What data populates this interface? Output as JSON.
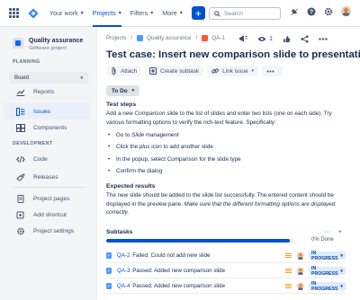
{
  "nav": {
    "your_work": "Your work",
    "projects": "Projects",
    "filters": "Filters",
    "more": "More",
    "create": "+",
    "search_placeholder": "Search"
  },
  "sidebar": {
    "project_name": "Quality assurance",
    "project_type": "Software project",
    "planning_label": "PLANNING",
    "board_select": "Board",
    "items_planning": [
      {
        "label": "Reports",
        "icon": "chart-icon"
      },
      {
        "label": "Issues",
        "icon": "issues-icon"
      },
      {
        "label": "Components",
        "icon": "components-icon"
      }
    ],
    "development_label": "DEVELOPMENT",
    "items_dev": [
      {
        "label": "Code",
        "icon": "code-icon"
      },
      {
        "label": "Releases",
        "icon": "ship-icon"
      }
    ],
    "items_bottom": [
      {
        "label": "Project pages",
        "icon": "page-icon"
      },
      {
        "label": "Add shortcut",
        "icon": "shortcut-icon"
      },
      {
        "label": "Project settings",
        "icon": "gear-icon"
      }
    ]
  },
  "issue": {
    "crumbs": [
      "Projects",
      "Quality assurance",
      "QA-1"
    ],
    "watch_count": "1",
    "title": "Test case: Insert new comparison slide to presentation",
    "buttons": [
      "Attach",
      "Create subtask",
      "Link issue"
    ],
    "status": "To Do",
    "test_steps_heading": "Test steps",
    "intro_a": "Add a new ",
    "intro_em1": "Comparison",
    "intro_b": " slide to the list of slides and enter two lists (one on each side). Try various formatting options to verify the rich-text feature. Specifically:",
    "steps": [
      {
        "a": "Go to ",
        "em": "Slide management",
        "b": ""
      },
      {
        "a": "Click the ",
        "em": "plus",
        "b": " icon to add another slide"
      },
      {
        "a": "In the popup, select Comparison for the slide type",
        "em": "",
        "b": ""
      },
      {
        "a": "Confirm the dialog",
        "em": "",
        "b": ""
      }
    ],
    "expected_heading": "Expected results",
    "expected_a": "The new slide should be added to the slide list successfully. The entered content should be displayed in the preview pane. ",
    "expected_em": "Make sure that the different formatting options are displayed correctly."
  },
  "subtasks": {
    "heading": "Subtasks",
    "progress_fraction": 0.98,
    "percent_done": "0% Done",
    "rows": [
      {
        "key": "QA-2",
        "summary": "Failed: Could not add new slide",
        "status": "IN PROGRESS"
      },
      {
        "key": "QA-3",
        "summary": "Passed: Added new comparison slide",
        "status": "IN PROGRESS"
      },
      {
        "key": "QA-4",
        "summary": "Passed: Added new comparison slide",
        "status": "IN PROGRESS"
      }
    ]
  },
  "colors": {
    "accent": "#0052cc",
    "status_bg": "#deebff",
    "priority": "#ff991f"
  }
}
